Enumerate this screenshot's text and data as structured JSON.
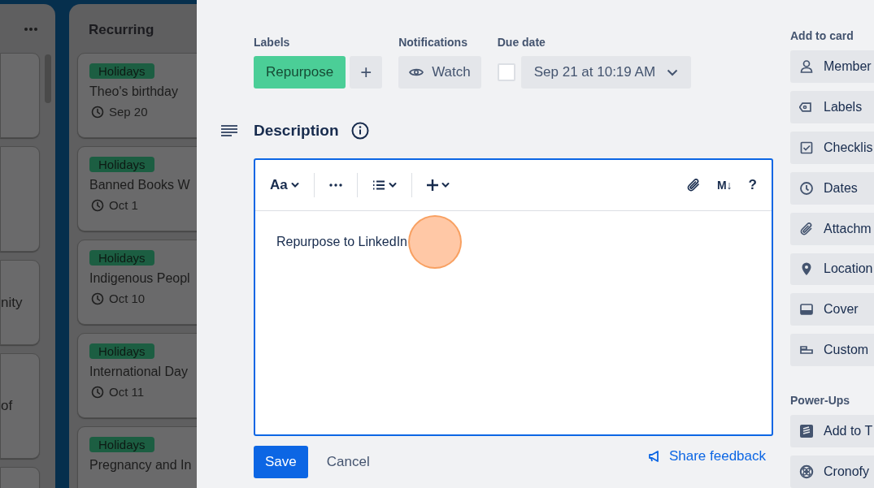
{
  "board": {
    "lists": [
      {
        "cards": [
          {
            "kind": "blank"
          },
          {
            "kind": "blank"
          },
          {
            "kind": "text",
            "visible_text": "nity"
          },
          {
            "kind": "text",
            "visible_text": "of"
          },
          {
            "kind": "blank"
          }
        ]
      },
      {
        "title": "Recurring",
        "cards": [
          {
            "label": "Holidays",
            "title": "Theo's birthday",
            "date": "Sep 20"
          },
          {
            "label": "Holidays",
            "title": "Banned Books W",
            "date": "Oct 1"
          },
          {
            "label": "Holidays",
            "title": "Indigenous Peopl",
            "date": "Oct 10"
          },
          {
            "label": "Holidays",
            "title": "International Day",
            "date": "Oct 11"
          },
          {
            "label": "Holidays",
            "title": "Pregnancy and In"
          }
        ]
      }
    ]
  },
  "card_detail": {
    "labels": {
      "heading": "Labels",
      "items": [
        {
          "text": "Repurpose",
          "color": "#4bce97"
        }
      ],
      "add_button": "+"
    },
    "notifications": {
      "heading": "Notifications",
      "button": "Watch"
    },
    "due_date": {
      "heading": "Due date",
      "checked": false,
      "value": "Sep 21 at 10:19 AM"
    },
    "description": {
      "heading": "Description",
      "toolbar": [
        {
          "kind": "text",
          "text": "Aa"
        },
        {
          "kind": "more"
        },
        {
          "kind": "list"
        },
        {
          "kind": "insert"
        },
        {
          "kind": "attach"
        },
        {
          "kind": "markdown",
          "text": "M↓"
        },
        {
          "kind": "help",
          "text": "?"
        }
      ],
      "value": "Repurpose to LinkedIn",
      "save": "Save",
      "cancel": "Cancel",
      "feedback": "Share feedback"
    },
    "sidebar": [
      {
        "heading": "Add to card",
        "buttons": [
          "Member",
          "Labels",
          "Checklis",
          "Dates",
          "Attachm",
          "Location",
          "Cover",
          "Custom"
        ]
      },
      {
        "heading": "Power-Ups",
        "buttons": [
          "Add to T",
          "Cronofy"
        ]
      }
    ]
  }
}
